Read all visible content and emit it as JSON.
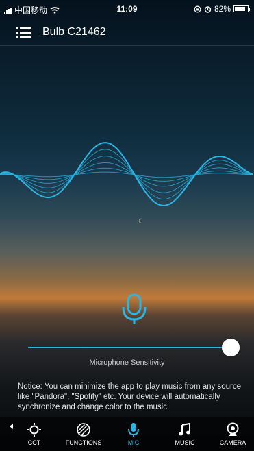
{
  "status_bar": {
    "carrier": "中国移动",
    "time": "11:09",
    "battery": "82%",
    "battery_level": 0.82
  },
  "header": {
    "title": "Bulb C21462"
  },
  "mic": {
    "sensitivity_label": "Microphone Sensitivity",
    "sensitivity_value": 1.0
  },
  "notice": "Notice: You can minimize the app to play music from any source like \"Pandora\", \"Spotify\" etc. Your device will automatically synchronize and change color to the music.",
  "tabs": [
    {
      "label": "CCT",
      "icon": "cct-icon",
      "active": false
    },
    {
      "label": "FUNCTIONS",
      "icon": "functions-icon",
      "active": false
    },
    {
      "label": "MIC",
      "icon": "mic-icon",
      "active": true
    },
    {
      "label": "MUSIC",
      "icon": "music-note-icon",
      "active": false
    },
    {
      "label": "CAMERA",
      "icon": "camera-icon",
      "active": false
    }
  ],
  "colors": {
    "accent": "#2bb6e6"
  }
}
